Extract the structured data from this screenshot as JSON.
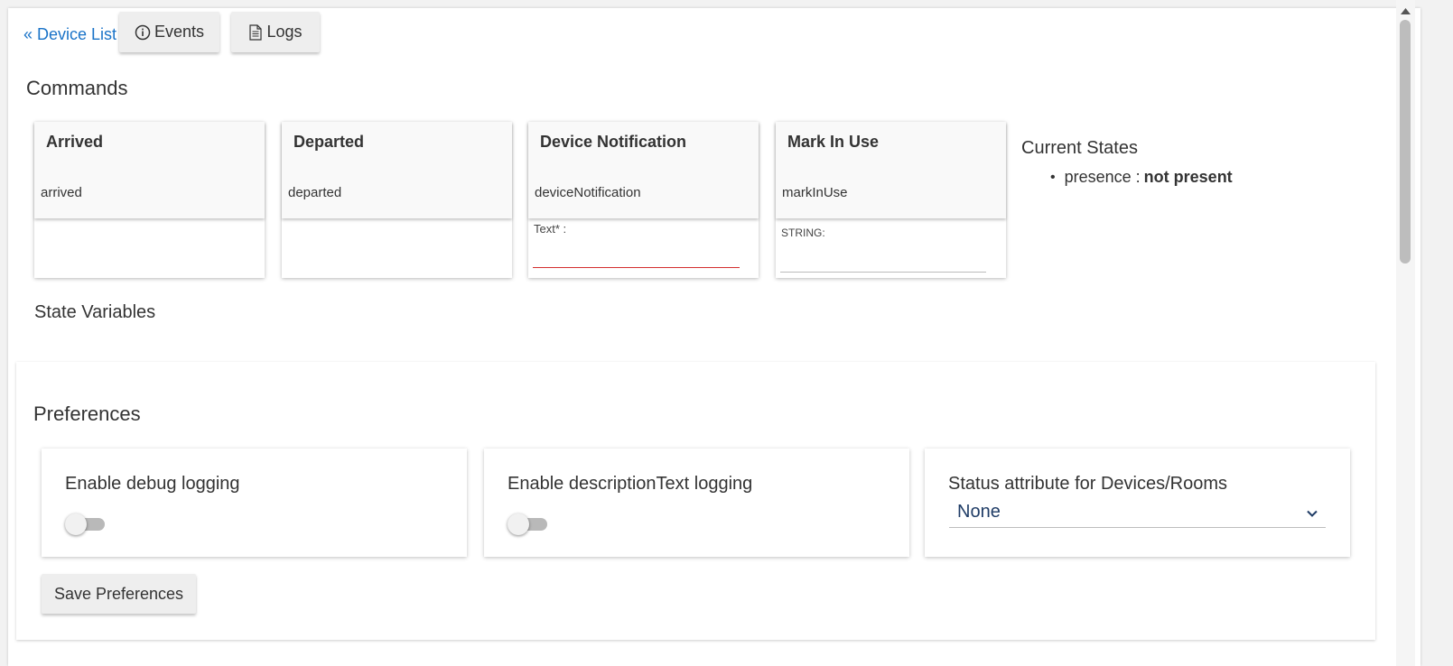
{
  "nav": {
    "back_label": "« Device List",
    "events_label": "Events",
    "logs_label": "Logs"
  },
  "commands": {
    "title": "Commands",
    "items": [
      {
        "title": "Arrived",
        "name": "arrived"
      },
      {
        "title": "Departed",
        "name": "departed"
      },
      {
        "title": "Device Notification",
        "name": "deviceNotification",
        "field_label": "Text* :"
      },
      {
        "title": "Mark In Use",
        "name": "markInUse",
        "field_label": "STRING:"
      }
    ]
  },
  "current_states": {
    "title": "Current States",
    "items": [
      {
        "key": "presence :",
        "value": "not present"
      }
    ]
  },
  "state_variables": {
    "title": "State Variables"
  },
  "preferences": {
    "title": "Preferences",
    "debug_logging": {
      "label": "Enable debug logging",
      "enabled": false
    },
    "desc_logging": {
      "label": "Enable descriptionText logging",
      "enabled": false
    },
    "status_attribute": {
      "label": "Status attribute for Devices/Rooms",
      "selected": "None"
    },
    "save_label": "Save Preferences"
  },
  "colors": {
    "link": "#1a73c8",
    "required_underline": "#d32f2f",
    "select_text": "#1f3c66"
  },
  "icons": {
    "events": "info-circle-icon",
    "logs": "document-icon",
    "select": "chevron-down-icon"
  }
}
